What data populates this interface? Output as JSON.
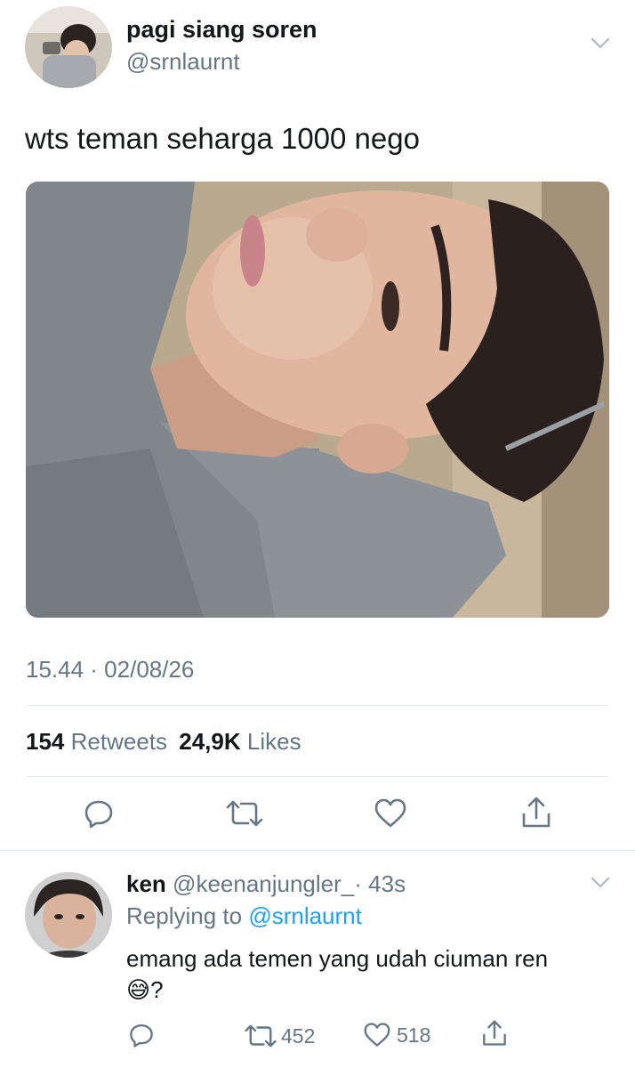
{
  "tweet": {
    "display_name": "pagi siang soren",
    "handle": "@srnlaurnt",
    "text": "wts teman seharga 1000 nego",
    "time": "15.44 · 02/08/26",
    "stats": {
      "retweets_count": "154",
      "retweets_label": "Retweets",
      "likes_count": "24,9K",
      "likes_label": "Likes"
    },
    "actions": [
      "reply-icon",
      "retweet-icon",
      "like-icon",
      "share-icon"
    ]
  },
  "reply": {
    "display_name": "ken",
    "handle": "@keenanjungler_",
    "age": "· 43s",
    "replying_prefix": "Replying to",
    "replying_handle": "@srnlaurnt",
    "text": "emang ada temen yang udah ciuman ren",
    "emoji": "😅",
    "text_suffix": "?",
    "retweet_count": "452",
    "like_count": "518"
  },
  "colors": {
    "text": "#14171a",
    "muted": "#657786",
    "link": "#1da1f2",
    "divider": "#e1e8ed"
  }
}
